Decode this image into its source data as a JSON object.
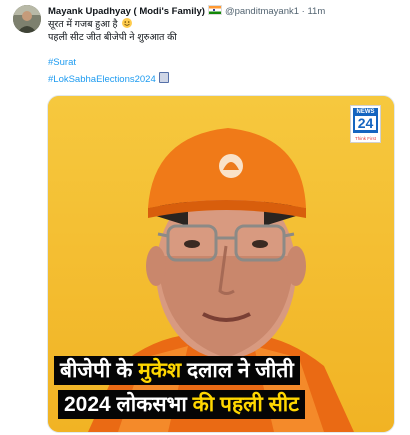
{
  "tweet": {
    "author_name": "Mayank Upadhyay ( Modi's Family)",
    "handle": "@panditmayank1",
    "separator": "·",
    "time": "11m",
    "line1": "सूरत में गजब हुआ है",
    "line2": "पहली सीट जीत बीजेपी ने शुरुआत की",
    "hashtag1": "#Surat",
    "hashtag2": "#LokSabhaElections2024"
  },
  "media": {
    "logo_news": "NEWS",
    "logo_24": "24",
    "logo_sub": "Think First",
    "caption_line1_white": "बीजेपी के",
    "caption_line1_yellow": "मुकेश",
    "caption_line1_white2": "दलाल ने जीती",
    "caption_line2_white": "2024 लोकसभा",
    "caption_line2_yellow": "की पहली सीट"
  },
  "colors": {
    "link": "#1d9bf0",
    "muted": "#536471",
    "text": "#0f1419",
    "caption_bg": "#050505",
    "caption_highlight": "#ffd700",
    "image_bg": "#f4c23a"
  },
  "icons": [
    "avatar",
    "india-flag-icon",
    "grinning-emoji-icon",
    "ballot-box-icon",
    "news24-logo"
  ]
}
